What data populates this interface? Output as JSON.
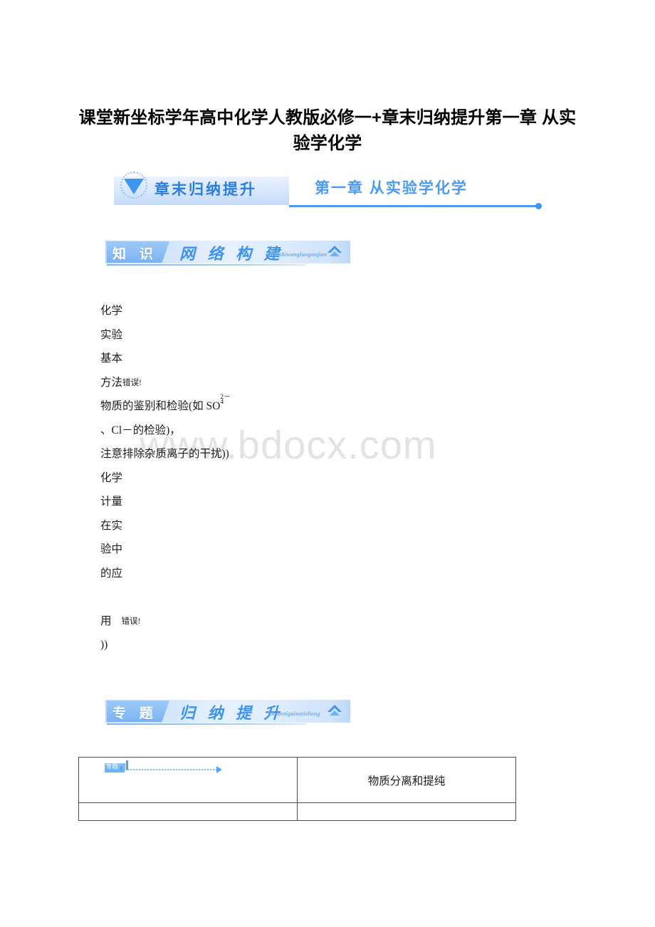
{
  "document": {
    "title": "课堂新坐标学年高中化学人教版必修一+章末归纳提升第一章 从实验学化学",
    "watermark": "www.bdocx.com"
  },
  "chapter_banner": {
    "tag_label": "章末归纳提升",
    "chapter_title": "第一章  从实验学化学",
    "triangle_icon": "triangle-down-icon",
    "accent_color": "#4b9bf2"
  },
  "section_banners": [
    {
      "tag": "知 识",
      "main": "网 络 构 建",
      "pinyin": "Zhishiwangluogoujian",
      "chevron_icon": "chevron-up-icon",
      "accent_color": "#3e93ef"
    },
    {
      "tag": "专 题",
      "main": "归 纳 提 升",
      "pinyin": "Zhuantiguinatisheng",
      "chevron_icon": "chevron-up-icon",
      "accent_color": "#3e93ef"
    }
  ],
  "body_lines": [
    {
      "text": "化学"
    },
    {
      "text": "实验"
    },
    {
      "text": "基本"
    },
    {
      "text": "方法",
      "small_suffix": "错误!"
    },
    {
      "text": "物质的鉴别和检验(如 SO",
      "formula": {
        "sup": "2－",
        "sub": "4"
      }
    },
    {
      "text": "、Cl－的检验)，"
    },
    {
      "text": "注意排除杂质离子的干扰))"
    },
    {
      "text": "化学"
    },
    {
      "text": "计量"
    },
    {
      "text": "在实"
    },
    {
      "text": "验中"
    },
    {
      "text": "的应"
    },
    {
      "text": ""
    },
    {
      "text": "用",
      "small_suffix": "错误!"
    },
    {
      "text": "))"
    }
  ],
  "topic_table": {
    "rows": [
      {
        "left_marker": {
          "tag_text": "专题",
          "icon": "bar-chart-icon",
          "arrow_icon": "dotted-arrow-right-icon"
        },
        "right": "物质分离和提纯"
      },
      {
        "left_marker": null,
        "right": ""
      }
    ]
  }
}
